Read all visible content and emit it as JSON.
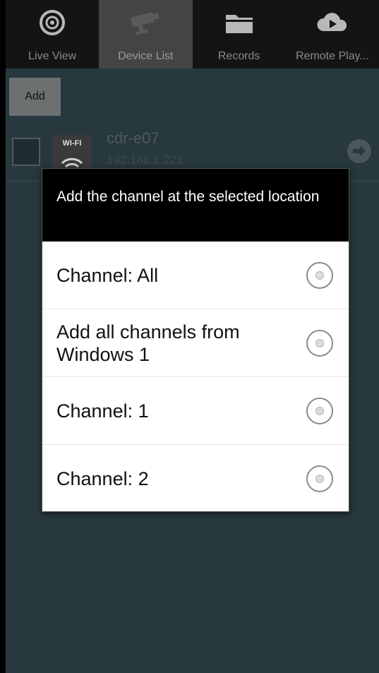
{
  "tabs": [
    {
      "label": "Live View",
      "icon": "live-view-icon",
      "active": false
    },
    {
      "label": "Device List",
      "icon": "camera-icon",
      "active": true
    },
    {
      "label": "Records",
      "icon": "folder-icon",
      "active": false
    },
    {
      "label": "Remote Play...",
      "icon": "cloud-play-icon",
      "active": false
    }
  ],
  "toolbar": {
    "add_label": "Add"
  },
  "device": {
    "badge": "WI-FI",
    "name": "cdr-e07",
    "ip": "192.168.1.221"
  },
  "dialog": {
    "title": "Add the channel at the selected location",
    "options": [
      {
        "label": "Channel: All",
        "selected": false
      },
      {
        "label": "Add all channels from Windows 1",
        "selected": false
      },
      {
        "label": "Channel: 1",
        "selected": false
      },
      {
        "label": "Channel: 2",
        "selected": false
      }
    ]
  },
  "colors": {
    "background": "#27383f",
    "tabbar": "#141414",
    "tab_active": "#444444",
    "dialog_title_bg": "#000000"
  }
}
